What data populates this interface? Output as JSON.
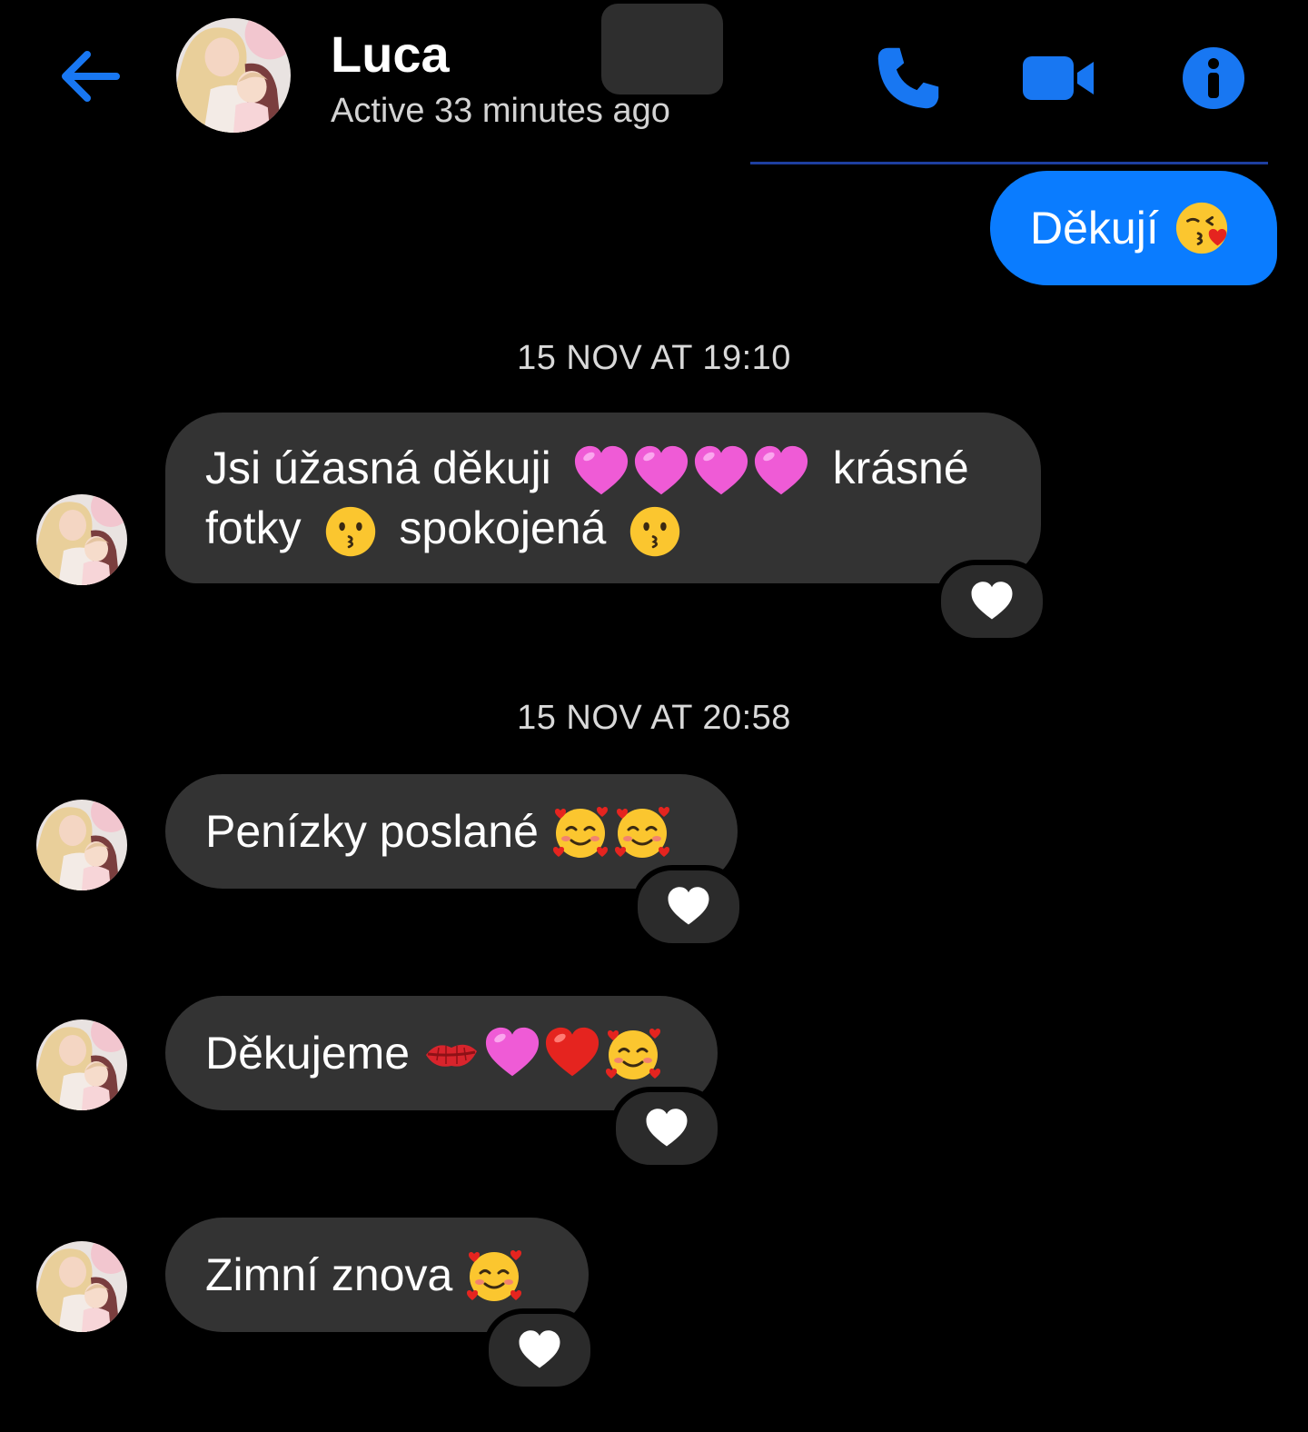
{
  "header": {
    "contact_name": "Luca",
    "status": "Active 33 minutes ago",
    "back_icon": "arrow-left-icon",
    "call_icon": "phone-icon",
    "video_icon": "video-camera-icon",
    "info_icon": "info-icon",
    "accent_color": "#0a7cff"
  },
  "messages": {
    "outgoing_1": {
      "text": "Děkují",
      "emoji": [
        "kissing-heart-face"
      ]
    },
    "timestamp_1": "15 NOV AT 19:10",
    "incoming_1": {
      "text_a": "Jsi úžasná děkuji",
      "text_b": "krásné",
      "text_c": "fotky",
      "text_d": "spokojená",
      "emoji": [
        "pink-heart",
        "pink-heart",
        "pink-heart",
        "pink-heart",
        "kissing-face",
        "kissing-face"
      ],
      "reaction": "white-heart"
    },
    "timestamp_2": "15 NOV AT 20:58",
    "incoming_2": {
      "text": "Penízky poslané",
      "emoji": [
        "smiling-face-with-hearts",
        "smiling-face-with-hearts"
      ],
      "reaction": "white-heart"
    },
    "incoming_3": {
      "text": "Děkujeme",
      "emoji": [
        "kiss-mark",
        "pink-heart",
        "red-heart",
        "smiling-face-with-hearts"
      ],
      "reaction": "white-heart"
    },
    "incoming_4": {
      "text": "Zimní znova",
      "emoji": [
        "smiling-face-with-hearts"
      ],
      "reaction": "white-heart"
    }
  },
  "colors": {
    "background": "#000000",
    "incoming_bubble": "#333333",
    "outgoing_bubble": "#0a7cff",
    "timestamp_text": "#d9d9d9"
  }
}
